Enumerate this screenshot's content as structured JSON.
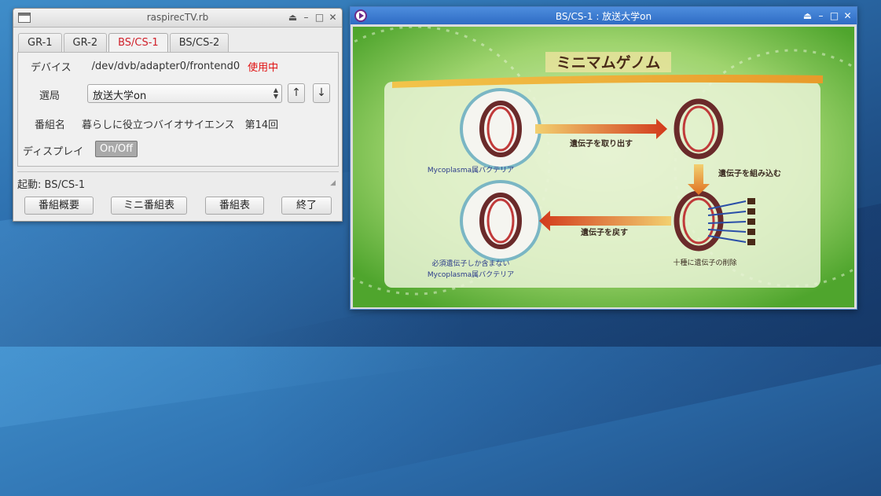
{
  "control_window": {
    "title": "raspirecTV.rb",
    "window_controls": [
      "⏏",
      "–",
      "□",
      "✕"
    ],
    "tabs": [
      {
        "label": "GR-1",
        "active": false
      },
      {
        "label": "GR-2",
        "active": false
      },
      {
        "label": "BS/CS-1",
        "active": true
      },
      {
        "label": "BS/CS-2",
        "active": false
      }
    ],
    "device": {
      "label": "デバイス",
      "value": "/dev/dvb/adapter0/frontend0",
      "status": "使用中"
    },
    "channel": {
      "label": "選局",
      "selected": "放送大学on",
      "up_label": "↑",
      "down_label": "↓"
    },
    "program": {
      "label": "番組名",
      "value": "暮らしに役立つバイオサイエンス　第14回"
    },
    "display": {
      "label": "ディスプレイ",
      "toggle_label": "On/Off"
    },
    "status_text": "起動: BS/CS-1",
    "buttons": {
      "overview": "番組概要",
      "mini_epg": "ミニ番組表",
      "epg": "番組表",
      "quit": "終了"
    }
  },
  "video_window": {
    "title": "BS/CS-1 : 放送大学on",
    "window_controls": [
      "⏏",
      "–",
      "□",
      "✕"
    ],
    "video_frame": {
      "heading": "ミニマムゲノム",
      "arrow_top": "遺伝子を取り出す",
      "arrow_right": "遺伝子を組み込む",
      "arrow_bottom": "遺伝子を戻す",
      "caption_top_left": "Mycoplasma属バクテリア",
      "caption_bottom_left_1": "必須遺伝子しか含まない",
      "caption_bottom_left_2": "Mycoplasma属バクテリア",
      "caption_bottom_right": "十種に遺伝子の削除"
    }
  },
  "colors": {
    "accent_active_tab": "#d0202a",
    "in_use": "#e01010",
    "video_title_bar": "#3a78cf",
    "video_bg": "#5fb33a"
  }
}
